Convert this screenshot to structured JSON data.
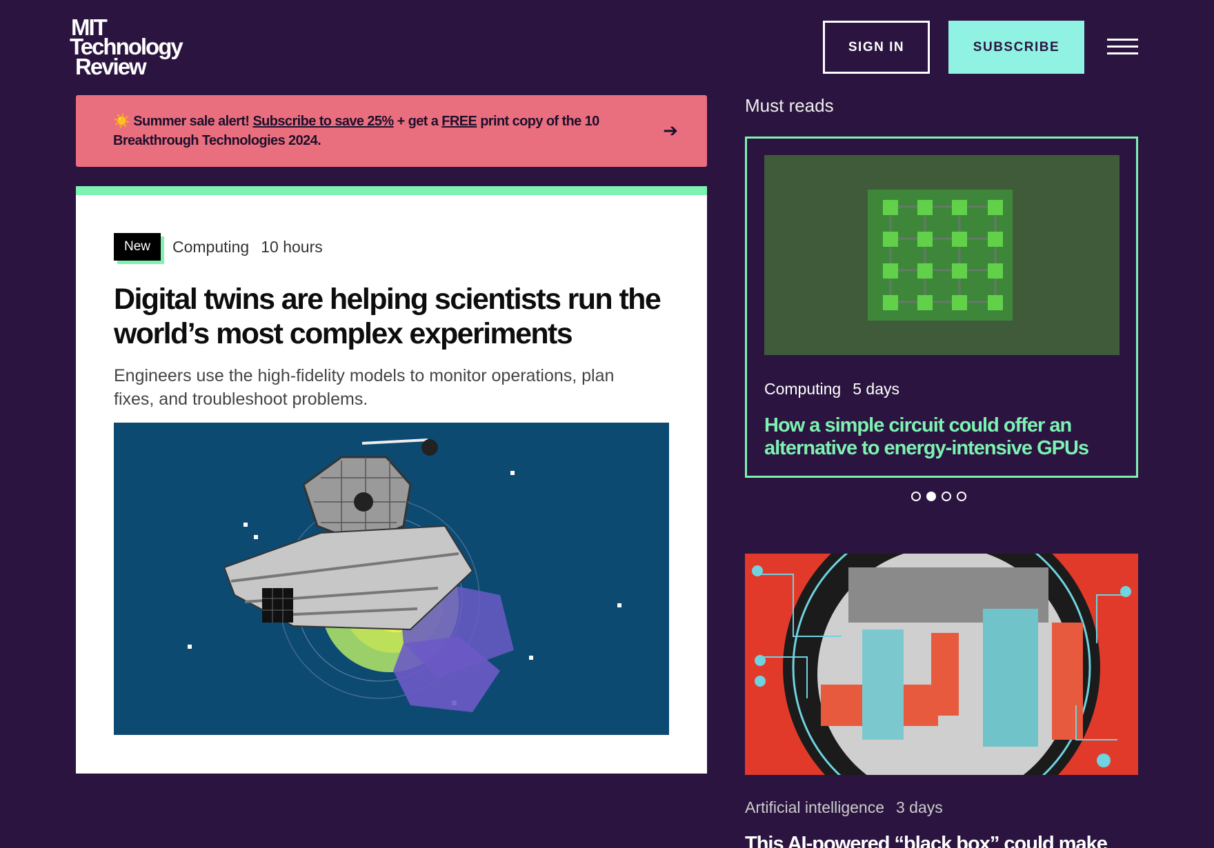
{
  "header": {
    "logo_line1": "MIT",
    "logo_line2": "Technology",
    "logo_line3": "Review",
    "sign_in_label": "SIGN IN",
    "subscribe_label": "SUBSCRIBE",
    "menu_icon": "hamburger-icon"
  },
  "promo": {
    "emoji": "☀️",
    "lead": "Summer sale alert!",
    "link1": "Subscribe to save 25%",
    "mid": "+ get a",
    "link2": "FREE",
    "tail": "print copy of the 10 Breakthrough Technologies 2024.",
    "arrow_icon": "arrow-right-icon"
  },
  "featured": {
    "badge": "New",
    "category": "Computing",
    "time": "10 hours",
    "headline": "Digital twins are helping scientists run the world’s most complex experiments",
    "dek": "Engineers use the high-fidelity models to monitor operations, plan fixes, and troubleshoot problems."
  },
  "must_reads": {
    "title": "Must reads",
    "card": {
      "category": "Computing",
      "time": "5 days",
      "headline": "How a simple circuit could offer an alternative to energy-intensive GPUs"
    },
    "dots_count": 4,
    "active_dot": 2
  },
  "article2": {
    "category": "Artificial intelligence",
    "time": "3 days",
    "headline": "This AI-powered “black box” could make"
  },
  "colors": {
    "background": "#2b1540",
    "accent_mint": "#7df2b1",
    "subscribe_bg": "#8ff2e2",
    "promo_bg": "#ea6f7e"
  }
}
